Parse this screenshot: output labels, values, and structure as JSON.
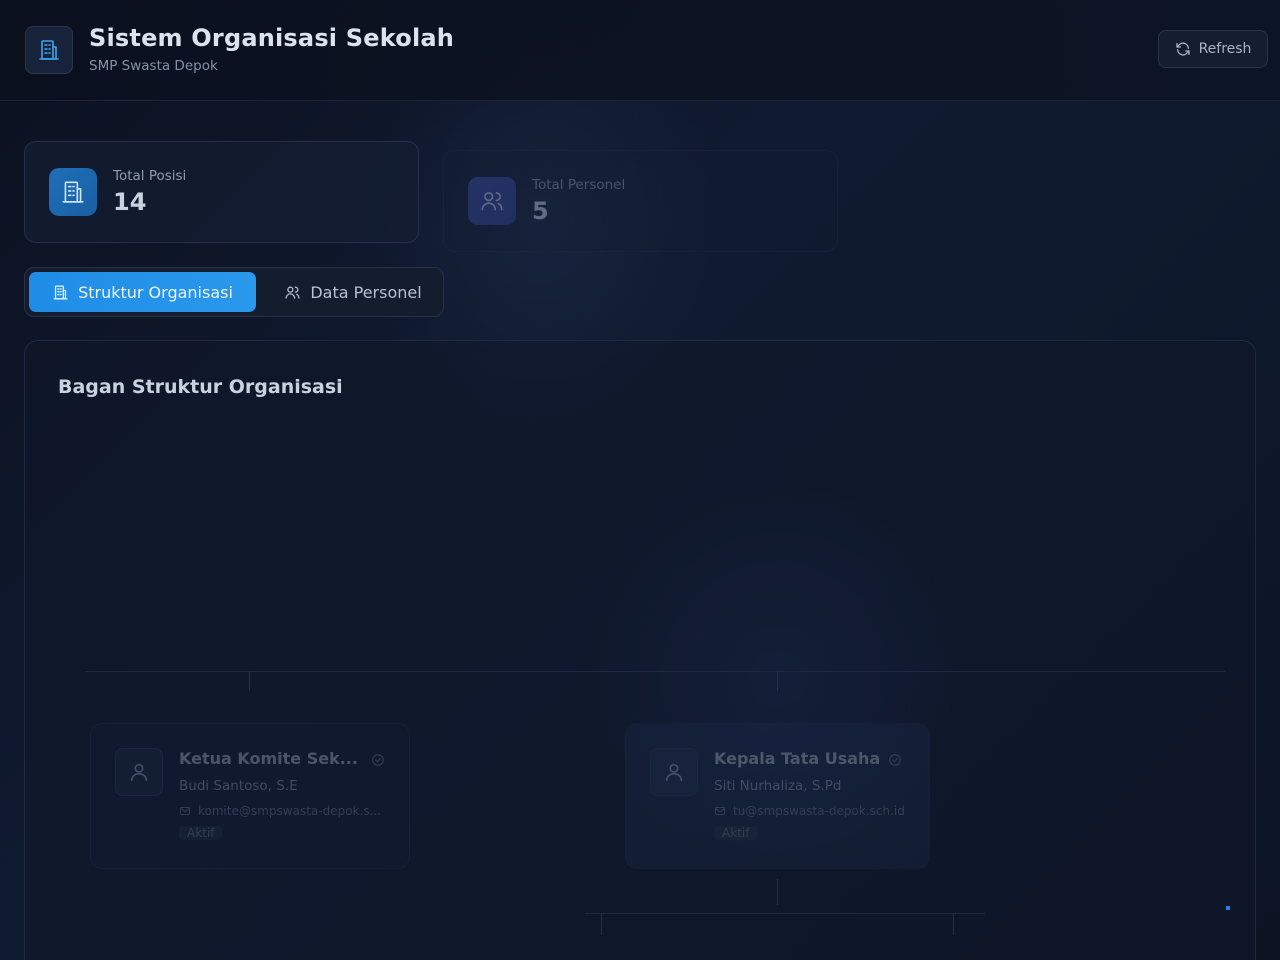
{
  "header": {
    "title": "Sistem Organisasi Sekolah",
    "subtitle": "SMP Swasta Depok",
    "refresh_label": "Refresh"
  },
  "stats": [
    {
      "label": "Total Posisi",
      "value": "14",
      "icon": "building-icon"
    },
    {
      "label": "Total Personel",
      "value": "5",
      "icon": "users-icon"
    }
  ],
  "tabs": [
    {
      "label": "Struktur Organisasi",
      "icon": "building-icon",
      "active": true
    },
    {
      "label": "Data Personel",
      "icon": "users-icon",
      "active": false
    }
  ],
  "chart": {
    "title": "Bagan Struktur Organisasi",
    "nodes": [
      {
        "title": "Ketua Komite Sek...",
        "person": "Budi Santoso, S.E",
        "email": "komite@smpswasta-depok.s...",
        "status": "Aktif"
      },
      {
        "title": "Kepala Tata Usaha",
        "person": "Siti Nurhaliza, S.Pd",
        "email": "tu@smpswasta-depok.sch.id",
        "status": "Aktif"
      }
    ]
  },
  "colors": {
    "accent": "#2196f3",
    "background": "#0f172a",
    "card": "#141e32"
  }
}
